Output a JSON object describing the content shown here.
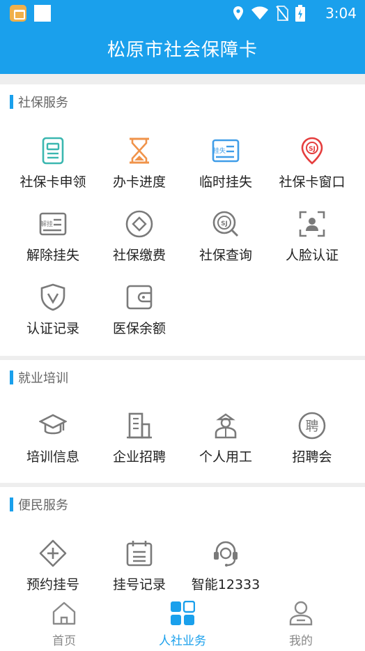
{
  "status_bar": {
    "time": "3:04"
  },
  "header": {
    "title": "松原市社会保障卡"
  },
  "sections": [
    {
      "title": "社保服务",
      "items": [
        {
          "label": "社保卡申领",
          "icon": "card-apply-icon"
        },
        {
          "label": "办卡进度",
          "icon": "hourglass-icon"
        },
        {
          "label": "临时挂失",
          "icon": "temp-loss-card-icon"
        },
        {
          "label": "社保卡窗口",
          "icon": "location-pin-icon"
        },
        {
          "label": "解除挂失",
          "icon": "release-loss-card-icon"
        },
        {
          "label": "社保缴费",
          "icon": "payment-diamond-icon"
        },
        {
          "label": "社保查询",
          "icon": "search-icon"
        },
        {
          "label": "人脸认证",
          "icon": "face-scan-icon"
        },
        {
          "label": "认证记录",
          "icon": "shield-check-icon"
        },
        {
          "label": "医保余额",
          "icon": "wallet-icon"
        }
      ]
    },
    {
      "title": "就业培训",
      "items": [
        {
          "label": "培训信息",
          "icon": "graduation-cap-icon"
        },
        {
          "label": "企业招聘",
          "icon": "building-icon"
        },
        {
          "label": "个人用工",
          "icon": "worker-icon"
        },
        {
          "label": "招聘会",
          "icon": "recruit-badge-icon"
        }
      ]
    },
    {
      "title": "便民服务",
      "items": [
        {
          "label": "预约挂号",
          "icon": "plus-diamond-icon"
        },
        {
          "label": "挂号记录",
          "icon": "calendar-record-icon"
        },
        {
          "label": "智能12333",
          "icon": "headset-service-icon"
        }
      ]
    }
  ],
  "tabs": [
    {
      "label": "首页",
      "icon": "home-icon",
      "active": false
    },
    {
      "label": "人社业务",
      "icon": "grid-apps-icon",
      "active": true
    },
    {
      "label": "我的",
      "icon": "user-icon",
      "active": false
    }
  ],
  "colors": {
    "primary": "#1aa0ec",
    "teal": "#3bb7b0",
    "orange": "#f0934a",
    "blue": "#3f9de8",
    "red": "#e53d3d",
    "gray": "#7a7a7a"
  },
  "icon_glyphs": {
    "temp_loss": "挂失",
    "release_loss": "解挂",
    "recruit": "聘",
    "social_security": "SJ"
  }
}
